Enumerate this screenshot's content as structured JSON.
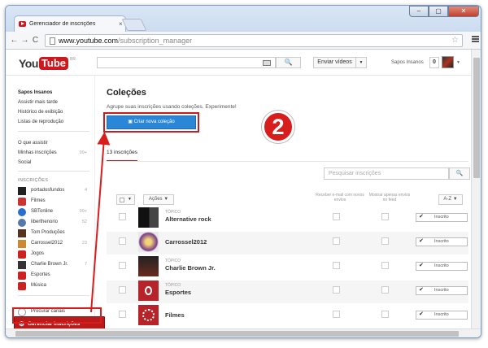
{
  "browser": {
    "tab_title": "Gerenciador de inscrições",
    "tab_close": "×",
    "url_host": "www.youtube.com",
    "url_path": "/subscription_manager",
    "back": "←",
    "forward": "→",
    "reload": "C",
    "star": "☆",
    "window_min": "–",
    "window_max": "▢",
    "window_close": "✕"
  },
  "masthead": {
    "logo_you": "You",
    "logo_tube": "Tube",
    "logo_region": "BR",
    "search_button": "🔍",
    "upload_label": "Enviar vídeos",
    "upload_dropdown": "▼",
    "account_name": "Sapos Insanos",
    "notifications": "0",
    "avatar_dropdown": "▼"
  },
  "sidebar": {
    "user_name": "Sapos Insanos",
    "links": [
      "Assistir mais tarde",
      "Histórico de exibição",
      "Listas de reprodução"
    ],
    "nav": [
      {
        "label": "O que assistir",
        "count": ""
      },
      {
        "label": "Minhas inscrições",
        "count": "99+"
      },
      {
        "label": "Social",
        "count": ""
      }
    ],
    "section_title": "INSCRIÇÕES",
    "subscriptions": [
      {
        "label": "portadosfundos",
        "count": "4",
        "icon_color": "#222222"
      },
      {
        "label": "Filmes",
        "count": "",
        "icon_color": "#cc3333"
      },
      {
        "label": "SBTonline",
        "count": "99+",
        "icon_color": "#2a6fc9"
      },
      {
        "label": "liberthenorio",
        "count": "52",
        "icon_color": "#5577aa"
      },
      {
        "label": "Tom Produções",
        "count": "",
        "icon_color": "#553322"
      },
      {
        "label": "Carrossel2012",
        "count": "23",
        "icon_color": "#cc8833"
      },
      {
        "label": "Jogos",
        "count": "",
        "icon_color": "#cc2222"
      },
      {
        "label": "Charlie Brown Jr.",
        "count": "7",
        "icon_color": "#333333"
      },
      {
        "label": "Esportes",
        "count": "",
        "icon_color": "#cc2222"
      },
      {
        "label": "Música",
        "count": "",
        "icon_color": "#cc2222"
      }
    ],
    "browse_channels": "Procurar canais",
    "manage_subscriptions": "Gerenciar inscrições"
  },
  "main": {
    "title": "Coleções",
    "description": "Agrupe suas inscrições usando coleções. Experimente!",
    "create_button": "Criar nova coleção",
    "step_badge": "2",
    "tab_count": "13 inscrições",
    "filter_placeholder": "Pesquisar inscrições",
    "filter_button": "🔍",
    "actions_label": "Ações ▼",
    "col_email": "Receber e-mail com novos envios",
    "col_feed": "Mostrar apenas envios no feed",
    "sort_label": "A-Z ▼",
    "topic_label": "TÓPICO",
    "subscribed_label": "Inscrito",
    "rows": [
      {
        "name": "Alternative rock",
        "topic": true
      },
      {
        "name": "Carrossel2012",
        "topic": false
      },
      {
        "name": "Charlie Brown Jr.",
        "topic": true
      },
      {
        "name": "Esportes",
        "topic": true
      },
      {
        "name": "Filmes",
        "topic": false
      }
    ]
  },
  "colors": {
    "accent": "#cc181e",
    "button_blue": "#2a86d6",
    "annotation_red": "#d81d1d"
  }
}
